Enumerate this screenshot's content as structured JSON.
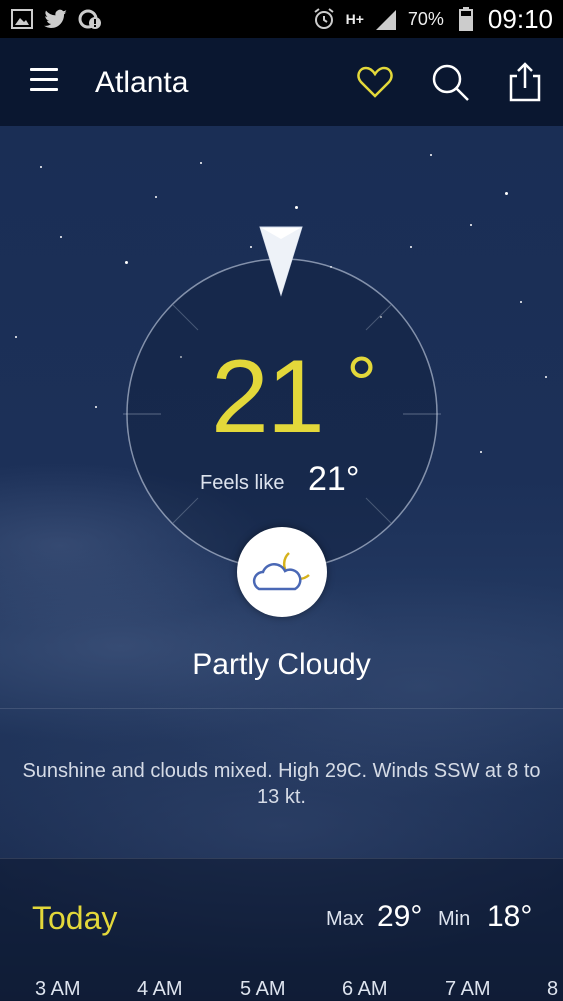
{
  "status_bar": {
    "battery": "70%",
    "network": "H+",
    "clock": "09:10"
  },
  "app_bar": {
    "city": "Atlanta",
    "icons": [
      "menu-icon",
      "heart-icon",
      "search-icon",
      "share-icon"
    ]
  },
  "current": {
    "temperature": "21",
    "degree_symbol": "°",
    "feels_like_label": "Feels like",
    "feels_like_value": "21°",
    "condition": "Partly Cloudy",
    "condition_icon": "partly-cloudy-night-icon",
    "summary": "Sunshine and clouds mixed. High 29C. Winds SSW at 8 to 13 kt."
  },
  "today": {
    "label": "Today",
    "max_label": "Max",
    "max_value": "29°",
    "min_label": "Min",
    "min_value": "18°"
  },
  "hourly": [
    "3 AM",
    "4 AM",
    "5 AM",
    "6 AM",
    "7 AM",
    "8"
  ],
  "colors": {
    "accent_yellow": "#e3d83a",
    "app_bar": "#0a1730",
    "status_bar": "#000000"
  }
}
